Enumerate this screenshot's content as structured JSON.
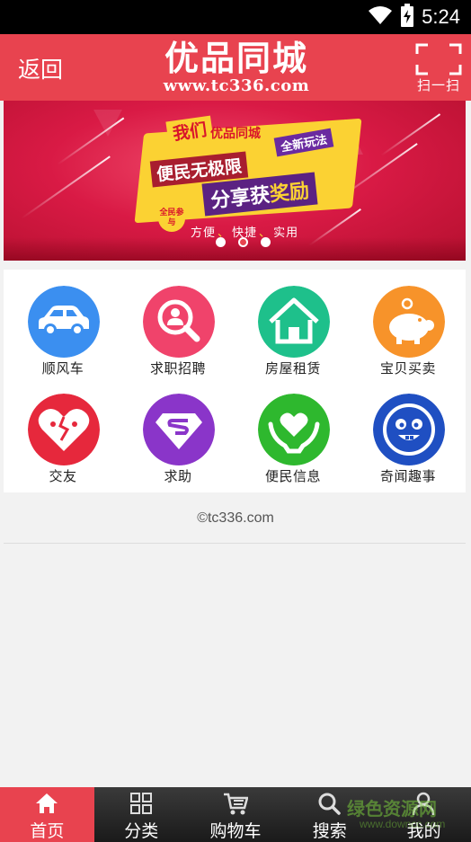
{
  "status_bar": {
    "time": "5:24",
    "icons": [
      "wifi-icon",
      "battery-charging-icon"
    ]
  },
  "header": {
    "back_label": "返回",
    "logo_title": "优品同城",
    "logo_url": "www.tc336.com",
    "scan_label": "扫一扫",
    "background": "#e8434f"
  },
  "banner": {
    "women": "我们",
    "brand": "优品同城",
    "new_play": "全新玩法",
    "line1": "便民无极限",
    "line2_a": "分享获",
    "line2_b": "奖励",
    "circle_text": "全民参与",
    "slogan": [
      "方便",
      "快捷",
      "实用"
    ],
    "slide_count": 3,
    "active_slide": 2
  },
  "categories": [
    {
      "label": "顺风车",
      "icon": "car-icon",
      "color": "#3b8ff0"
    },
    {
      "label": "求职招聘",
      "icon": "job-search-icon",
      "color": "#f0436b"
    },
    {
      "label": "房屋租赁",
      "icon": "house-icon",
      "color": "#1ec08b"
    },
    {
      "label": "宝贝买卖",
      "icon": "piggy-bank-icon",
      "color": "#f7932a"
    },
    {
      "label": "交友",
      "icon": "heart-face-icon",
      "color": "#e6283c"
    },
    {
      "label": "求助",
      "icon": "superman-icon",
      "color": "#8a35c9"
    },
    {
      "label": "便民信息",
      "icon": "hands-heart-icon",
      "color": "#2eb82e"
    },
    {
      "label": "奇闻趣事",
      "icon": "funny-face-icon",
      "color": "#1f4fc2"
    }
  ],
  "footer": {
    "copyright": "©tc336.com"
  },
  "bottom_nav": [
    {
      "label": "首页",
      "icon": "home-icon",
      "active": true
    },
    {
      "label": "分类",
      "icon": "grid-icon",
      "active": false
    },
    {
      "label": "购物车",
      "icon": "cart-icon",
      "active": false
    },
    {
      "label": "搜索",
      "icon": "search-icon",
      "active": false
    },
    {
      "label": "我的",
      "icon": "user-icon",
      "active": false
    }
  ],
  "watermark": {
    "text": "绿色资源网",
    "sub": "www.downcc.com"
  }
}
